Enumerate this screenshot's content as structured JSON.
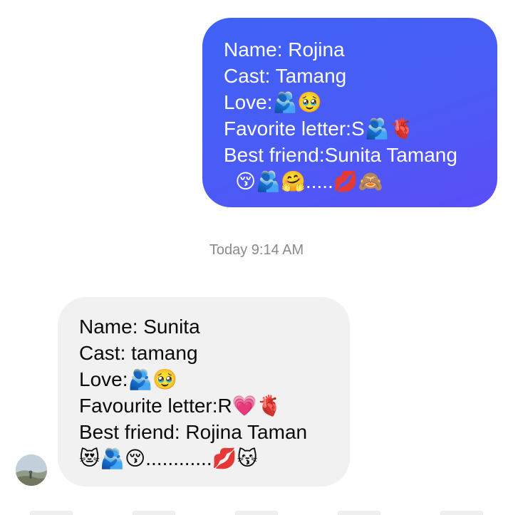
{
  "messages": {
    "sent": {
      "lines": [
        "Name: Rojina",
        "Cast: Tamang",
        "Love:🫂🥹",
        "Favorite letter:S🫂🫀",
        "Best friend:Sunita Tamang",
        "😚🫂🤗.....💋🙈"
      ]
    },
    "timestamp": "Today 9:14 AM",
    "received": {
      "lines": [
        "Name: Sunita",
        "Cast: tamang",
        "Love:🫂🥹",
        "Favourite letter:R💗🫀",
        "Best friend: Rojina Taman",
        "😻🫂😚............💋😽"
      ]
    }
  },
  "colors": {
    "sent_bubble_start": "#3f62f6",
    "sent_bubble_end": "#5b4ef7",
    "received_bubble": "#f1f1f1",
    "timestamp_text": "#8a8a8a"
  }
}
